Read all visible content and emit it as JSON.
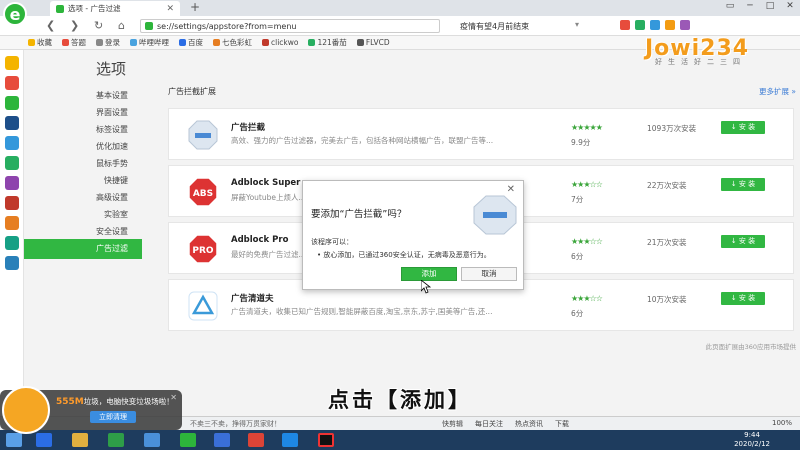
{
  "browser": {
    "tab_title": "选项 - 广告过滤",
    "tab_close": "✕",
    "new_tab": "+",
    "address": "se://settings/appstore?from=menu",
    "news": "疫情有望4月前结束",
    "window_controls": [
      "▭",
      "─",
      "□",
      "✕"
    ]
  },
  "bookmarks": [
    {
      "label": "收藏",
      "color": "#f4b400"
    },
    {
      "label": "答题",
      "color": "#e74c3c"
    },
    {
      "label": "登录",
      "color": "#888888"
    },
    {
      "label": "哔哩哔哩",
      "color": "#4aa3df"
    },
    {
      "label": "百度",
      "color": "#2b6de5"
    },
    {
      "label": "七色彩虹",
      "color": "#e67e22"
    },
    {
      "label": "clickwo",
      "color": "#c0392b"
    },
    {
      "label": "121番茄",
      "color": "#27ae60"
    },
    {
      "label": "FLVCD",
      "color": "#555555"
    }
  ],
  "watermark": {
    "big": "Jowi234",
    "small": "好生活好二三四"
  },
  "settings": {
    "title": "选项",
    "menu": [
      "基本设置",
      "界面设置",
      "标签设置",
      "优化加速",
      "鼠标手势",
      "快捷键",
      "高级设置",
      "实验室",
      "安全设置"
    ],
    "active": "广告过滤"
  },
  "main": {
    "section_title": "广告拦截扩展",
    "more_link": "更多扩展 »",
    "install_label": "↓ 安 装",
    "extensions": [
      {
        "name": "广告拦截",
        "desc": "高效、强力的广告过滤器，完美去广告，包括各种网站横幅广告，联盟广告等...",
        "stars": "★★★★★",
        "score": "9.9分",
        "installs": "1093万次安装"
      },
      {
        "name": "Adblock Super",
        "desc": "屏蔽Youtube上烦人...",
        "stars": "★★★☆☆",
        "score": "7分",
        "installs": "22万次安装"
      },
      {
        "name": "Adblock Pro",
        "desc": "最好的免费广告过滤...",
        "stars": "★★★☆☆",
        "score": "6分",
        "installs": "21万次安装"
      },
      {
        "name": "广告清道夫",
        "desc": "广告清道夫，收集已知广告规则,智能屏蔽百度,淘宝,京东,苏宁,国美等广告,还...",
        "stars": "★★★☆☆",
        "score": "6分",
        "installs": "10万次安装"
      }
    ],
    "footer_note": "此页面扩展由360应用市场提供"
  },
  "modal": {
    "title": "要添加“广告拦截”吗？",
    "label": "该程序可以：",
    "bullet": "•  放心添加，已通过360安全认证，无病毒及恶意行为。",
    "add": "添加",
    "cancel": "取消",
    "close": "✕"
  },
  "subtitle": "点击【添加】",
  "cleaner": {
    "size": "555M",
    "text": "垃圾，电脑快变垃圾场啦！",
    "button": "立即清理",
    "close": "✕"
  },
  "statusbar": {
    "left": "不卖三不卖，挣得万贯家财！",
    "items": [
      "快剪辑",
      "每日关注",
      "热点资讯",
      "下载"
    ],
    "zoom": "100%"
  },
  "taskbar": {
    "time": "9:44",
    "date": "2020/2/12"
  }
}
